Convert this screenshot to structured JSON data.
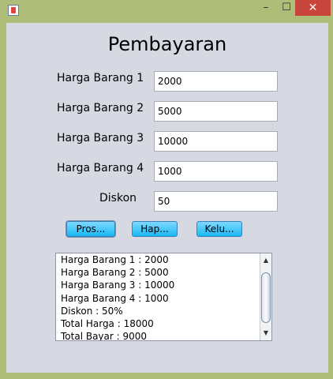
{
  "window": {
    "icon": "java-icon",
    "controls": {
      "minimize": "–",
      "maximize": "☐",
      "close": "✕"
    }
  },
  "form": {
    "title": "Pembayaran",
    "fields": [
      {
        "label": "Harga Barang 1",
        "value": "2000"
      },
      {
        "label": "Harga Barang 2",
        "value": "5000"
      },
      {
        "label": "Harga Barang 3",
        "value": "10000"
      },
      {
        "label": "Harga Barang 4",
        "value": "1000"
      },
      {
        "label": "Diskon",
        "value": "50"
      }
    ],
    "buttons": {
      "process": "Pros...",
      "delete": "Hap...",
      "exit": "Kelu..."
    }
  },
  "output": {
    "lines": [
      "Harga Barang 1 : 2000",
      "Harga Barang 2 : 5000",
      "Harga Barang 3 : 10000",
      "Harga Barang 4 : 1000",
      "Diskon : 50%",
      "Total Harga : 18000",
      "Total Bayar : 9000"
    ],
    "scroll": {
      "up": "▲",
      "down": "▼"
    }
  }
}
